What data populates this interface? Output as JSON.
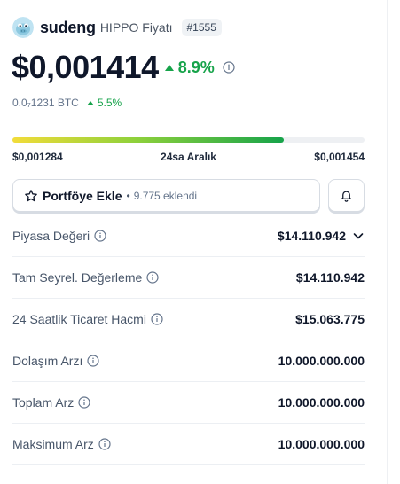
{
  "coin": {
    "name": "sudeng",
    "subtitle": "HIPPO Fiyatı",
    "rank": "#1555"
  },
  "price": {
    "value": "$0,001414",
    "change": "8.9%",
    "btc_value": "0.0₇1231 BTC",
    "btc_change": "5.5%",
    "trend": "up",
    "accent_color": "#16a34a"
  },
  "range": {
    "low": "$0,001284",
    "label": "24sa Aralık",
    "high": "$0,001454",
    "fill_fraction": 0.77
  },
  "portfolio": {
    "label": "Portföye Ekle",
    "separator": "•",
    "count": "9.775 eklendi",
    "icon": "star-icon"
  },
  "alert": {
    "icon": "bell-icon"
  },
  "stats": [
    {
      "label": "Piyasa Değeri",
      "value": "$14.110.942",
      "expandable": true
    },
    {
      "label": "Tam Seyrel. Değerleme",
      "value": "$14.110.942",
      "expandable": false
    },
    {
      "label": "24 Saatlik Ticaret Hacmi",
      "value": "$15.063.775",
      "expandable": false
    },
    {
      "label": "Dolaşım Arzı",
      "value": "10.000.000.000",
      "expandable": false
    },
    {
      "label": "Toplam Arz",
      "value": "10.000.000.000",
      "expandable": false
    },
    {
      "label": "Maksimum Arz",
      "value": "10.000.000.000",
      "expandable": false
    }
  ]
}
